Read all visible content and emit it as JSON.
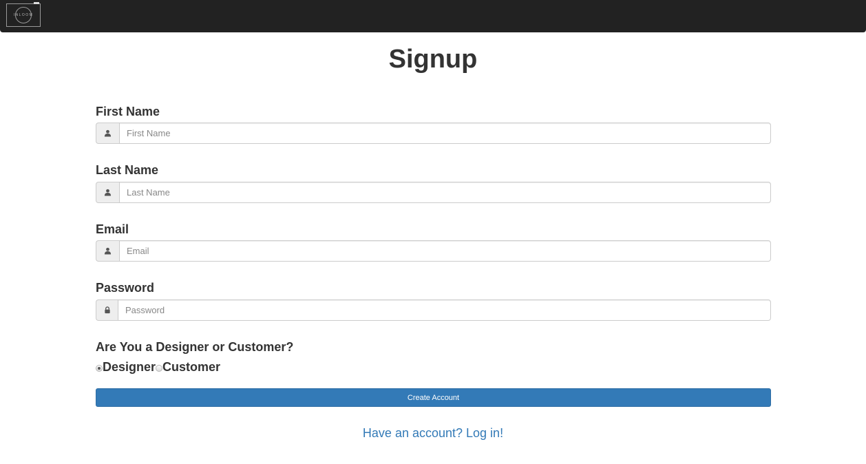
{
  "navbar": {
    "logo_text": "INLOOM",
    "background": "#222222"
  },
  "page": {
    "title": "Signup"
  },
  "form": {
    "fields": [
      {
        "label": "First Name",
        "placeholder": "First Name",
        "value": "",
        "icon": "user-icon"
      },
      {
        "label": "Last Name",
        "placeholder": "Last Name",
        "value": "",
        "icon": "user-icon"
      },
      {
        "label": "Email",
        "placeholder": "Email",
        "value": "",
        "icon": "user-icon"
      },
      {
        "label": "Password",
        "placeholder": "Password",
        "value": "",
        "icon": "lock-icon"
      }
    ],
    "role_question": "Are You a Designer or Customer?",
    "roles": [
      {
        "label": "Designer",
        "selected": true
      },
      {
        "label": "Customer",
        "selected": false
      }
    ],
    "submit_label": "Create Account",
    "login_link": "Have an account? Log in!"
  },
  "colors": {
    "primary": "#337ab7",
    "text": "#333333",
    "addon_bg": "#eeeeee"
  }
}
